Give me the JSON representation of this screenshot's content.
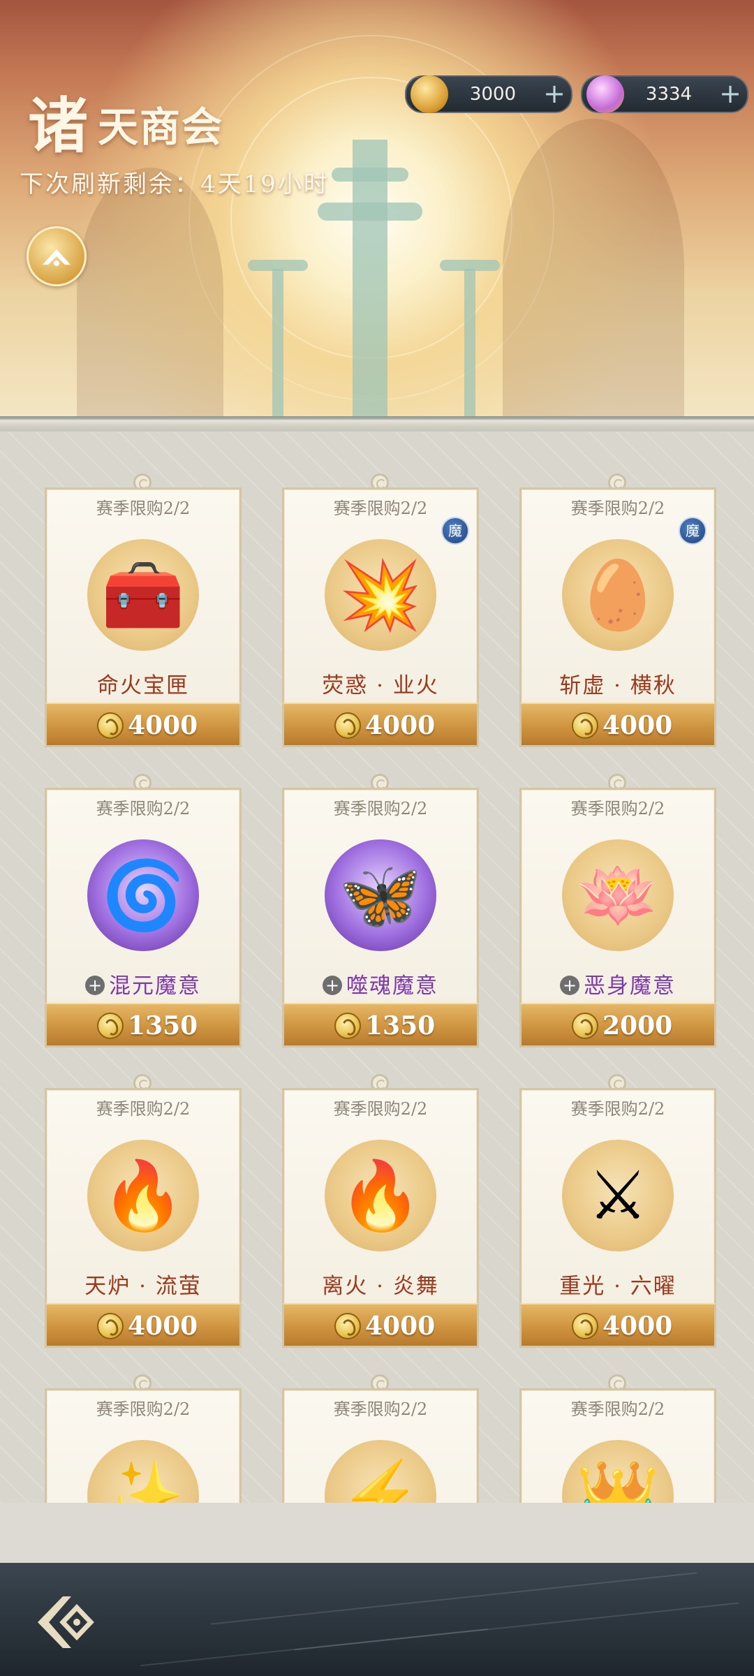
{
  "header": {
    "title_first": "诸",
    "title_rest": "天商会",
    "refresh_text": "下次刷新剩余：4天19小时"
  },
  "currencies": [
    {
      "name": "coin-currency",
      "value": "3000",
      "plus": "+",
      "color": "#e0b347"
    },
    {
      "name": "crystal-currency",
      "value": "3334",
      "plus": "+",
      "color": "#c46bd6"
    }
  ],
  "items": [
    {
      "limit": "赛季限购2/2",
      "name": "命火宝匣",
      "price": "4000",
      "badge": "",
      "demon": false,
      "icon": "treasure-chest-icon",
      "glyph": "🧰"
    },
    {
      "limit": "赛季限购2/2",
      "name": "荧惑 · 业火",
      "price": "4000",
      "badge": "魔",
      "demon": false,
      "icon": "fire-burst-scroll-icon",
      "glyph": "💥"
    },
    {
      "limit": "赛季限购2/2",
      "name": "斩虚 · 横秋",
      "price": "4000",
      "badge": "魔",
      "demon": false,
      "icon": "golden-seeds-scroll-icon",
      "glyph": "🥚"
    },
    {
      "limit": "赛季限购2/2",
      "name": "混元魔意",
      "price": "1350",
      "badge": "",
      "demon": true,
      "icon": "purple-vortex-icon",
      "glyph": "🌀"
    },
    {
      "limit": "赛季限购2/2",
      "name": "噬魂魔意",
      "price": "1350",
      "badge": "",
      "demon": true,
      "icon": "purple-butterfly-orb-icon",
      "glyph": "🦋"
    },
    {
      "limit": "赛季限购2/2",
      "name": "恶身魔意",
      "price": "2000",
      "badge": "",
      "demon": true,
      "icon": "purple-lotus-swirl-icon",
      "glyph": "🪷"
    },
    {
      "limit": "赛季限购2/2",
      "name": "天炉 · 流萤",
      "price": "4000",
      "badge": "",
      "demon": false,
      "icon": "flame-wings-scroll-icon",
      "glyph": "🔥"
    },
    {
      "limit": "赛季限购2/2",
      "name": "离火 · 炎舞",
      "price": "4000",
      "badge": "",
      "demon": false,
      "icon": "flame-crown-scroll-icon",
      "glyph": "🔥"
    },
    {
      "limit": "赛季限购2/2",
      "name": "重光 · 六曜",
      "price": "4000",
      "badge": "",
      "demon": false,
      "icon": "golden-blades-scroll-icon",
      "glyph": "⚔"
    },
    {
      "limit": "赛季限购2/2",
      "name": "",
      "price": "",
      "badge": "",
      "demon": false,
      "icon": "golden-spirit-icon",
      "glyph": "✨"
    },
    {
      "limit": "赛季限购2/2",
      "name": "",
      "price": "",
      "badge": "",
      "demon": true,
      "icon": "purple-lightning-icon",
      "glyph": "⚡"
    },
    {
      "limit": "赛季限购2/2",
      "name": "",
      "price": "",
      "badge": "",
      "demon": true,
      "icon": "purple-crown-icon",
      "glyph": "👑"
    }
  ]
}
